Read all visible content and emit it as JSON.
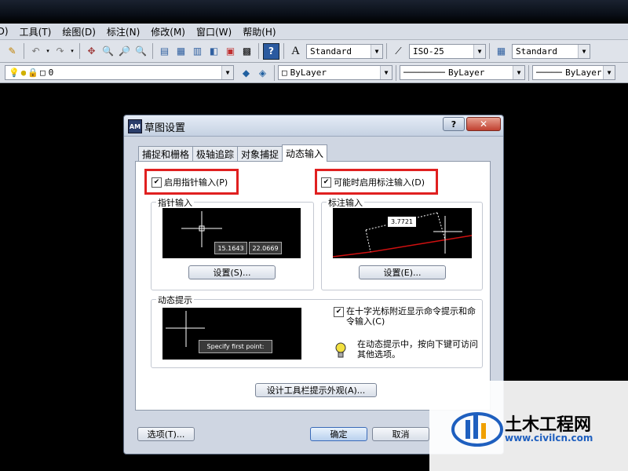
{
  "menu": [
    "(D)",
    "工具(T)",
    "绘图(D)",
    "标注(N)",
    "修改(M)",
    "窗口(W)",
    "帮助(H)"
  ],
  "toolbar": {
    "text_style": "Standard",
    "dim_style": "ISO-25",
    "table_style": "Standard",
    "layer": "0",
    "color": "ByLayer",
    "linetype": "ByLayer",
    "lineweight": "ByLayer"
  },
  "dialog": {
    "title": "草图设置",
    "tabs": [
      "捕捉和栅格",
      "极轴追踪",
      "对象捕捉",
      "动态输入"
    ],
    "active_tab": "动态输入",
    "pointer_input": {
      "enable_label": "启用指针输入(P)",
      "checked": true,
      "group_label": "指针输入",
      "coord_x": "15.1643",
      "coord_y": "22.0669",
      "settings_button": "设置(S)..."
    },
    "dimension_input": {
      "enable_label": "可能时启用标注输入(D)",
      "checked": true,
      "group_label": "标注输入",
      "dim_value": "3.7721",
      "settings_button": "设置(E)..."
    },
    "dynamic_prompts": {
      "group_label": "动态提示",
      "prompt_text": "Specify first point:",
      "show_prompts_label": "在十字光标附近显示命令提示和命令输入(C)",
      "checked": true,
      "tip_text": "在动态提示中，按向下键可访问其他选项。"
    },
    "drafting_tooltip_button": "设计工具栏提示外观(A)...",
    "options_button": "选项(T)...",
    "ok_button": "确定",
    "cancel_button": "取消"
  },
  "watermark": {
    "title": "土木工程网",
    "url": "www.civilcn.com"
  }
}
